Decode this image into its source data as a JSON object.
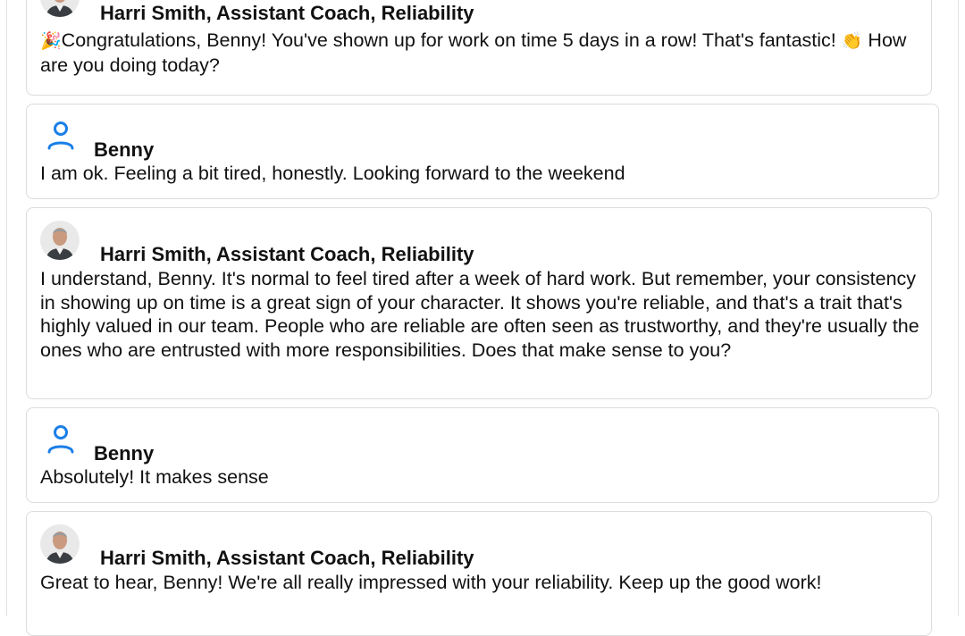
{
  "conversation": {
    "messages": [
      {
        "role": "coach",
        "name": "Harri Smith, Assistant Coach, Reliability",
        "emoji_start": "🎉",
        "text_part1": "Congratulations, Benny! You've shown up for work on time 5 days in a row! That's fantastic!",
        "emoji_mid": "👏",
        "text_part2": "How are you doing today?"
      },
      {
        "role": "user",
        "name": "Benny",
        "text": "I am ok. Feeling a bit tired, honestly. Looking forward to the weekend"
      },
      {
        "role": "coach",
        "name": "Harri Smith, Assistant Coach, Reliability",
        "text": "I understand, Benny. It's normal to feel tired after a week of hard work. But remember, your consistency in showing up on time is a great sign of your character. It shows you're reliable, and that's a trait that's highly valued in our team. People who are reliable are often seen as trustworthy, and they're usually the ones who are entrusted with more responsibilities. Does that make sense to you?"
      },
      {
        "role": "user",
        "name": "Benny",
        "text": "Absolutely! It makes sense"
      },
      {
        "role": "coach",
        "name": "Harri Smith, Assistant Coach, Reliability",
        "text": "Great to hear, Benny! We're all really impressed with your reliability. Keep up the good work!"
      }
    ]
  },
  "icons": {
    "coach_avatar": "coach-avatar-photo",
    "user_icon": "user-icon"
  },
  "colors": {
    "user_icon": "#1a7fe8",
    "card_border": "#dcdcdc"
  }
}
